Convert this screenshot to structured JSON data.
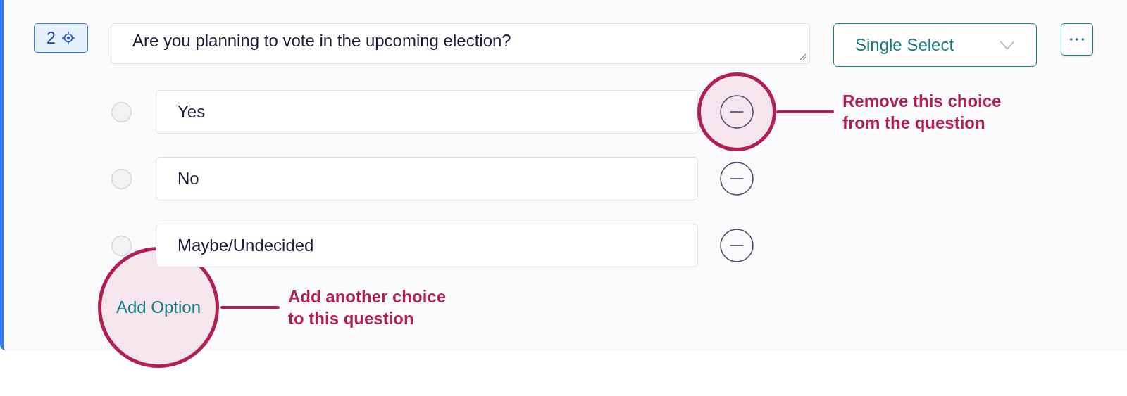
{
  "question": {
    "number": "2",
    "text": "Are you planning to vote in the upcoming election?",
    "type": "Single Select"
  },
  "options": [
    {
      "label": "Yes",
      "selected": false,
      "callout": "Remove this choice from the question"
    },
    {
      "label": "No",
      "selected": false
    },
    {
      "label": "Maybe/Undecided",
      "selected": false
    }
  ],
  "add_option": {
    "label": "Add Option",
    "callout": "Add another choice to this question"
  }
}
